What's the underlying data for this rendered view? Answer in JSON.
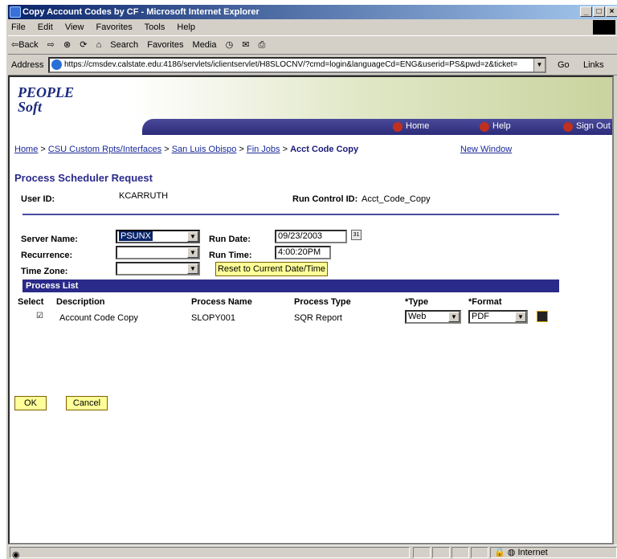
{
  "window": {
    "title": "Copy Account Codes by CF - Microsoft Internet Explorer",
    "min_glyph": "_",
    "max_glyph": "□",
    "close_glyph": "×"
  },
  "menu": [
    "File",
    "Edit",
    "View",
    "Favorites",
    "Tools",
    "Help"
  ],
  "toolbar": {
    "back": "⇦Back",
    "search": "Search",
    "favorites": "Favorites",
    "media": "Media"
  },
  "address": {
    "label": "Address",
    "url": "https://cmsdev.calstate.edu:4186/servlets/iclientservlet/H8SLOCNV/?cmd=login&languageCd=ENG&userid=PS&pwd=z&ticket=",
    "go": "Go",
    "links": "Links"
  },
  "nav": {
    "home": "Home",
    "help": "Help",
    "signout": "Sign Out"
  },
  "breadcrumb": {
    "items": [
      "Home",
      "CSU Custom Rpts/Interfaces",
      "San Luis Obispo",
      "Fin Jobs"
    ],
    "separator": ">",
    "current": "Acct Code Copy",
    "new_window": "New Window"
  },
  "page_title": "Process Scheduler Request",
  "user": {
    "label": "User ID:",
    "value": "KCARRUTH",
    "run_control_label": "Run Control ID:",
    "run_control_value": "Acct_Code_Copy"
  },
  "form": {
    "server_label": "Server Name:",
    "server_value": "PSUNX",
    "recurrence_label": "Recurrence:",
    "recurrence_value": "",
    "timezone_label": "Time Zone:",
    "timezone_value": "",
    "run_date_label": "Run Date:",
    "run_date_value": "09/23/2003",
    "run_time_label": "Run Time:",
    "run_time_value": "4:00:20PM",
    "reset_button": "Reset to Current Date/Time"
  },
  "process_list": {
    "header": "Process List",
    "columns": [
      "Select",
      "Description",
      "Process Name",
      "Process Type",
      "*Type",
      "*Format"
    ],
    "rows": [
      {
        "selected": "☑",
        "description": "Account Code Copy",
        "process_name": "SLOPY001",
        "process_type": "SQR Report",
        "type": "Web",
        "format": "PDF"
      }
    ]
  },
  "buttons": {
    "ok": "OK",
    "cancel": "Cancel"
  },
  "status": {
    "zone": "Internet"
  },
  "brand": {
    "logo_line1": "PEOPLE",
    "logo_line2": "Soft"
  }
}
